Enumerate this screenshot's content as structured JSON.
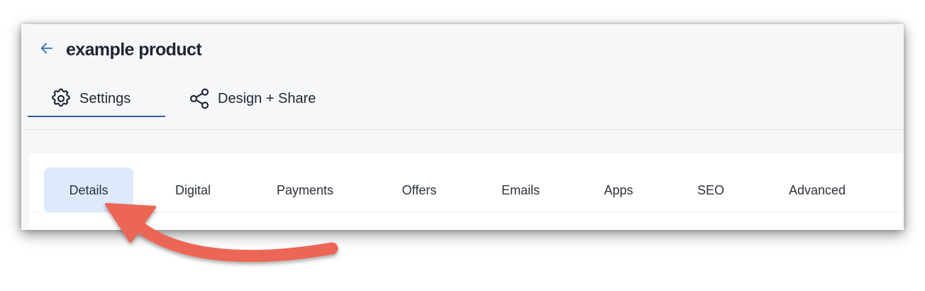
{
  "header": {
    "back_icon": "arrow-left-icon",
    "title": "example product"
  },
  "main_tabs": [
    {
      "label": "Settings",
      "icon": "gear-icon",
      "active": true
    },
    {
      "label": "Design + Share",
      "icon": "share-icon",
      "active": false
    }
  ],
  "sub_tabs": [
    {
      "label": "Details",
      "active": true
    },
    {
      "label": "Digital",
      "active": false
    },
    {
      "label": "Payments",
      "active": false
    },
    {
      "label": "Offers",
      "active": false
    },
    {
      "label": "Emails",
      "active": false
    },
    {
      "label": "Apps",
      "active": false
    },
    {
      "label": "SEO",
      "active": false
    },
    {
      "label": "Advanced",
      "active": false
    }
  ],
  "annotation": {
    "type": "curved-arrow",
    "color": "#ec6656",
    "points_to": "Details"
  },
  "colors": {
    "accent": "#2f5fa8",
    "active_subtab_bg": "#ddeafb",
    "text": "#1f2633"
  }
}
